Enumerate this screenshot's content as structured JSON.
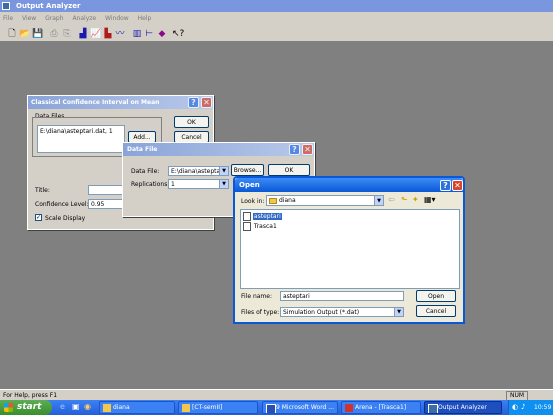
{
  "app": {
    "title": "Output Analyzer",
    "menu": [
      "File",
      "View",
      "Graph",
      "Analyze",
      "Window",
      "Help"
    ],
    "toolbar_icons": [
      "new-icon",
      "open-icon",
      "save-icon",
      "print-icon",
      "print-preview-icon",
      "histogram-icon",
      "plot-icon",
      "bar-chart-icon",
      "moving-average-icon",
      "batch-means-icon",
      "correlogram-icon",
      "interval-icon",
      "context-help-icon"
    ],
    "status_left": "For Help, press F1",
    "status_num": "NUM"
  },
  "ci_dialog": {
    "title": "Classical Confidence Interval on Mean",
    "data_files_group": "Data Files",
    "data_files": [
      "E:\\diana\\asteptari.dat, 1"
    ],
    "ok": "OK",
    "cancel": "Cancel",
    "add": "Add...",
    "title_label": "Title:",
    "title_value": "",
    "confidence_label": "Confidence Level:",
    "confidence_value": "0.95",
    "scale_display": "Scale Display",
    "scale_checked": true
  },
  "data_file_dialog": {
    "title": "Data File",
    "data_file_label": "Data File:",
    "data_file_value": "E:\\diana\\asteptari",
    "browse": "Browse...",
    "replications_label": "Replications:",
    "replications_value": "1",
    "ok": "OK"
  },
  "open_dialog": {
    "title": "Open",
    "look_in_label": "Look in:",
    "look_in_value": "diana",
    "files": [
      {
        "name": "asteptari",
        "selected": true
      },
      {
        "name": "Trasca1",
        "selected": false
      }
    ],
    "file_name_label": "File name:",
    "file_name_value": "asteptari",
    "files_of_type_label": "Files of type:",
    "files_of_type_value": "Simulation Output (*.dat)",
    "open": "Open",
    "cancel": "Cancel"
  },
  "taskbar": {
    "start": "start",
    "items": [
      "diana",
      "[CT-semII]",
      "9 Microsoft Word ...",
      "Arena - [Trasca1]",
      "Output Analyzer"
    ],
    "time": "10:59"
  }
}
